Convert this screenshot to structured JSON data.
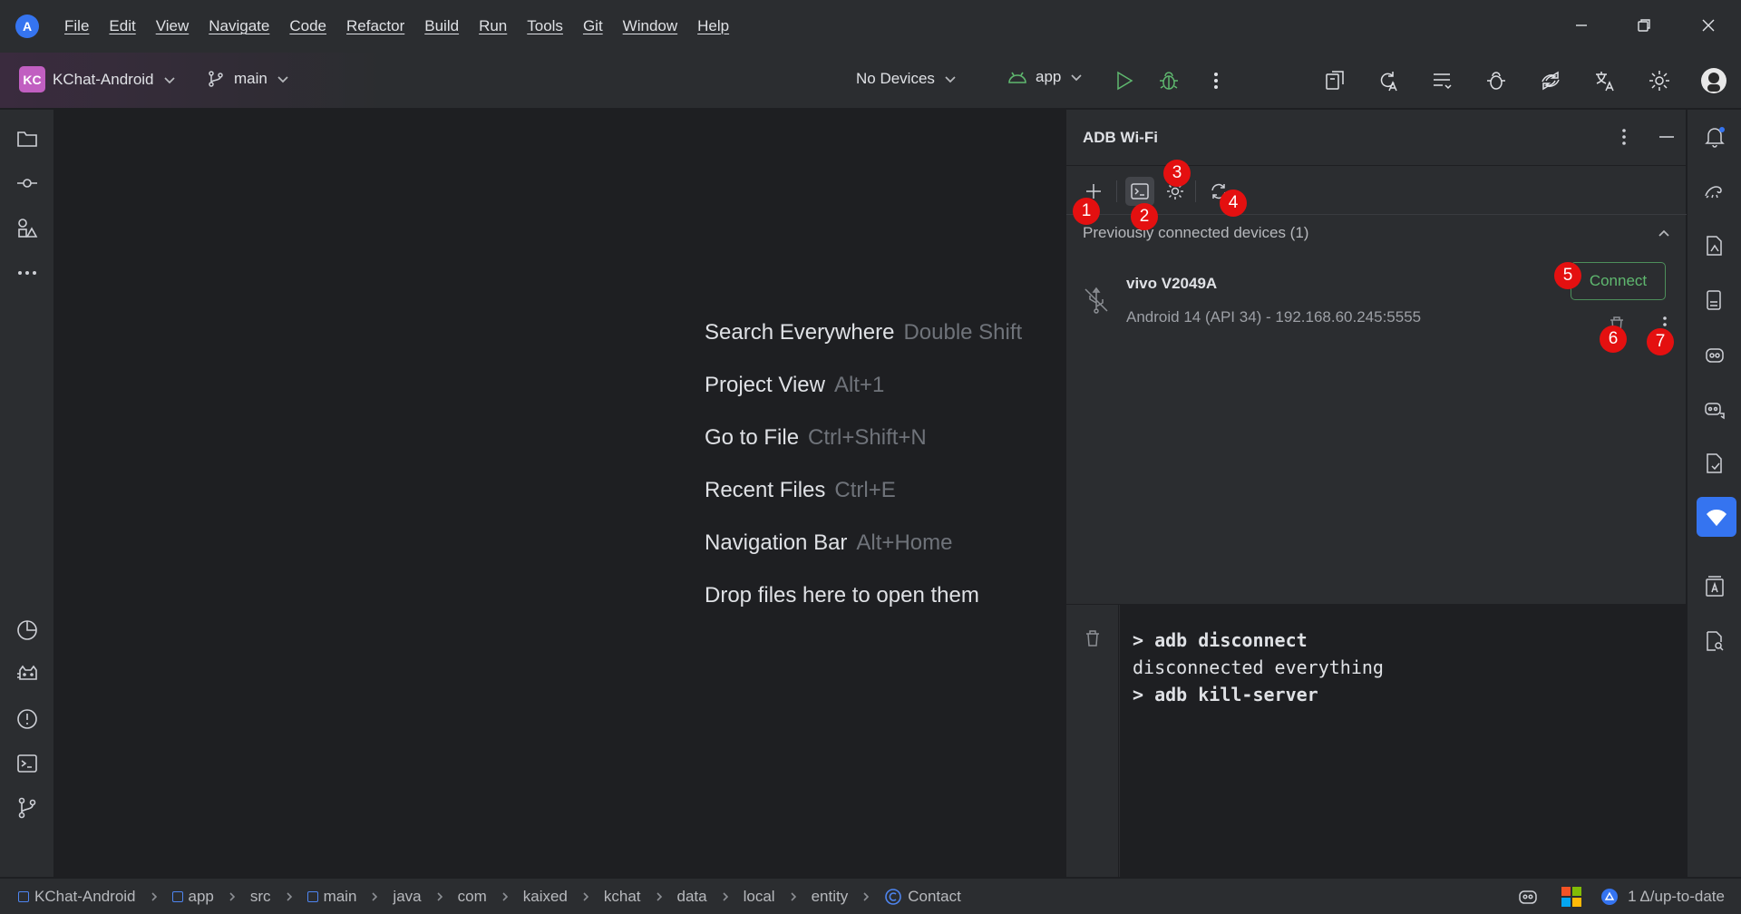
{
  "titlebar": {
    "logo_glyph": "A",
    "menu": [
      "File",
      "Edit",
      "View",
      "Navigate",
      "Code",
      "Refactor",
      "Build",
      "Run",
      "Tools",
      "Git",
      "Window",
      "Help"
    ]
  },
  "toolbar": {
    "project_badge": "KC",
    "project_name": "KChat-Android",
    "branch": "main",
    "devices": "No Devices",
    "run_config": "app"
  },
  "welcome": {
    "hints": [
      {
        "label": "Search Everywhere",
        "shortcut": "Double Shift"
      },
      {
        "label": "Project View",
        "shortcut": "Alt+1"
      },
      {
        "label": "Go to File",
        "shortcut": "Ctrl+Shift+N"
      },
      {
        "label": "Recent Files",
        "shortcut": "Ctrl+E"
      },
      {
        "label": "Navigation Bar",
        "shortcut": "Alt+Home"
      },
      {
        "label": "Drop files here to open them",
        "shortcut": ""
      }
    ]
  },
  "adb": {
    "title": "ADB Wi-Fi",
    "section": "Previously connected devices (1)",
    "device_name": "vivo V2049A",
    "device_detail": "Android 14 (API 34) - 192.168.60.245:5555",
    "connect_label": "Connect",
    "markers": [
      "1",
      "2",
      "3",
      "4",
      "5",
      "6",
      "7"
    ],
    "log": [
      "> adb disconnect",
      "disconnected everything",
      "> adb kill-server"
    ]
  },
  "statusbar": {
    "crumbs": [
      "KChat-Android",
      "app",
      "src",
      "main",
      "java",
      "com",
      "kaixed",
      "kchat",
      "data",
      "local",
      "entity",
      "Contact"
    ],
    "vcs": "1 Δ/up-to-date"
  },
  "colors": {
    "accent": "#3574f0",
    "marker": "#e41010",
    "connect": "#5fb86f",
    "project_badge": "#c15fc1"
  }
}
